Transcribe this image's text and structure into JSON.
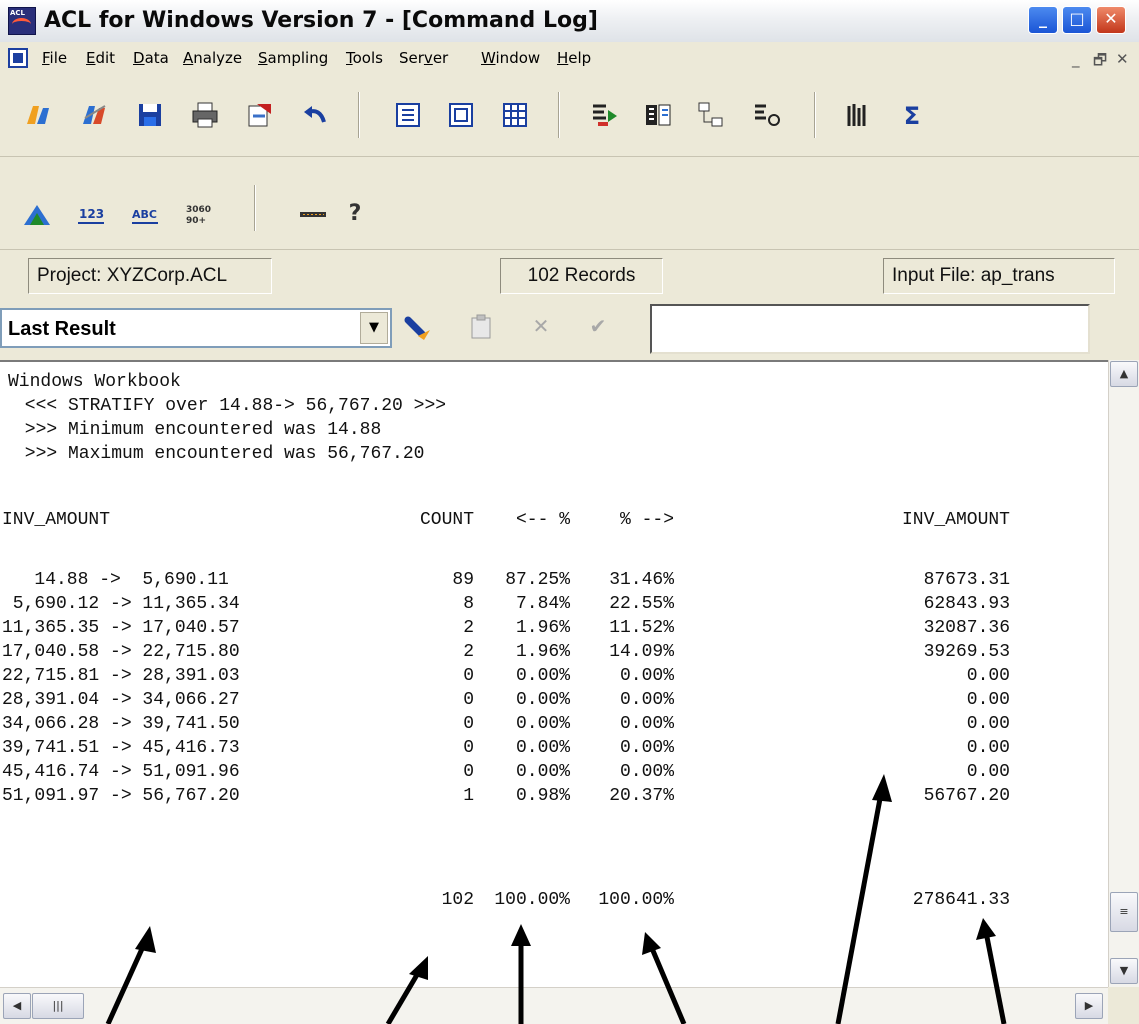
{
  "window": {
    "title": "ACL for Windows Version 7 - [Command Log]",
    "app_icon_text": "ACL",
    "controls": {
      "minimize": "_",
      "maximize": "□",
      "close": "✕"
    }
  },
  "menu": {
    "items": [
      {
        "pre": "",
        "u": "F",
        "post": "ile"
      },
      {
        "pre": "",
        "u": "E",
        "post": "dit"
      },
      {
        "pre": "",
        "u": "D",
        "post": "ata"
      },
      {
        "pre": "",
        "u": "A",
        "post": "nalyze"
      },
      {
        "pre": "",
        "u": "S",
        "post": "ampling"
      },
      {
        "pre": "",
        "u": "T",
        "post": "ools"
      },
      {
        "pre": "Ser",
        "u": "v",
        "post": "er"
      },
      {
        "pre": "",
        "u": "W",
        "post": "indow"
      },
      {
        "pre": "",
        "u": "H",
        "post": "elp"
      }
    ],
    "mdi": {
      "minimize": "_",
      "restore": "🗗",
      "close": "✕"
    }
  },
  "toolbar1_icons": [
    "open-project-icon",
    "close-project-icon",
    "save-icon",
    "print-icon",
    "export-icon",
    "undo-icon",
    "table-layout-icon",
    "view-icon",
    "grid-icon",
    "extract-icon",
    "sort-icon",
    "join-icon",
    "merge-icon",
    "stratify-icon",
    "total-icon"
  ],
  "toolbar2_icons": [
    "histogram-icon",
    "numeric-format-icon",
    "text-format-icon",
    "age-icon",
    "separator-line-icon",
    "help-icon"
  ],
  "status": {
    "project": "Project: XYZCorp.ACL",
    "records": "102 Records",
    "input_file": "Input File: ap_trans"
  },
  "result_selector": {
    "value": "Last Result"
  },
  "log": {
    "header_lines": [
      "Windows Workbook",
      " <<< STRATIFY over 14.88-> 56,767.20 >>>",
      " >>> Minimum encountered was 14.88",
      " >>> Maximum encountered was 56,767.20"
    ],
    "columns": [
      "INV_AMOUNT",
      "COUNT",
      "<-- %",
      "% -->",
      "INV_AMOUNT"
    ],
    "rows": [
      {
        "range": "   14.88 ->  5,690.11",
        "count": "89",
        "pct_count": "87.25%",
        "pct_amount": "31.46%",
        "amount": "87673.31"
      },
      {
        "range": " 5,690.12 -> 11,365.34",
        "count": "8",
        "pct_count": "7.84%",
        "pct_amount": "22.55%",
        "amount": "62843.93"
      },
      {
        "range": "11,365.35 -> 17,040.57",
        "count": "2",
        "pct_count": "1.96%",
        "pct_amount": "11.52%",
        "amount": "32087.36"
      },
      {
        "range": "17,040.58 -> 22,715.80",
        "count": "2",
        "pct_count": "1.96%",
        "pct_amount": "14.09%",
        "amount": "39269.53"
      },
      {
        "range": "22,715.81 -> 28,391.03",
        "count": "0",
        "pct_count": "0.00%",
        "pct_amount": "0.00%",
        "amount": "0.00"
      },
      {
        "range": "28,391.04 -> 34,066.27",
        "count": "0",
        "pct_count": "0.00%",
        "pct_amount": "0.00%",
        "amount": "0.00"
      },
      {
        "range": "34,066.28 -> 39,741.50",
        "count": "0",
        "pct_count": "0.00%",
        "pct_amount": "0.00%",
        "amount": "0.00"
      },
      {
        "range": "39,741.51 -> 45,416.73",
        "count": "0",
        "pct_count": "0.00%",
        "pct_amount": "0.00%",
        "amount": "0.00"
      },
      {
        "range": "45,416.74 -> 51,091.96",
        "count": "0",
        "pct_count": "0.00%",
        "pct_amount": "0.00%",
        "amount": "0.00"
      },
      {
        "range": "51,091.97 -> 56,767.20",
        "count": "1",
        "pct_count": "0.98%",
        "pct_amount": "20.37%",
        "amount": "56767.20"
      }
    ],
    "totals": {
      "count": "102",
      "pct_count": "100.00%",
      "pct_amount": "100.00%",
      "amount": "278641.33"
    }
  },
  "colors": {
    "title_bar": "#e6e9ee",
    "chrome": "#ece9d8",
    "log_background": "#ffffff",
    "arrow": "#000000"
  }
}
